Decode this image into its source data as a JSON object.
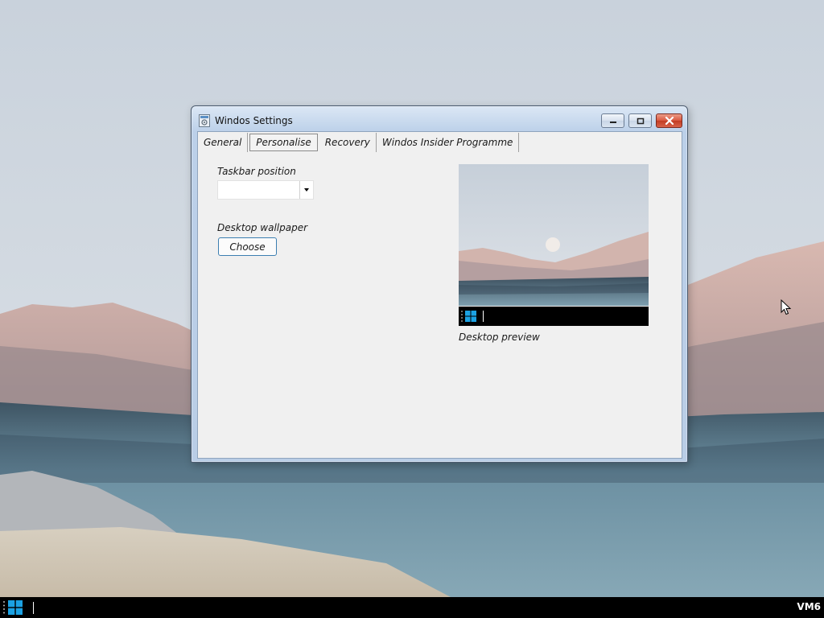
{
  "window": {
    "title": "Windos Settings",
    "tabs": [
      {
        "label": "General",
        "active": false
      },
      {
        "label": "Personalise",
        "active": true
      },
      {
        "label": "Recovery",
        "active": false
      },
      {
        "label": "Windos Insider Programme",
        "active": false
      }
    ]
  },
  "personalise": {
    "taskbar_position_label": "Taskbar position",
    "taskbar_position_value": "",
    "desktop_wallpaper_label": "Desktop wallpaper",
    "choose_button_label": "Choose",
    "desktop_preview_label": "Desktop preview"
  },
  "taskbar": {
    "tray_text": "VM6"
  },
  "icons": {
    "start": "windows-logo-icon",
    "app": "settings-app-icon",
    "cursor": "mouse-pointer-icon"
  },
  "colors": {
    "accent": "#3c7fb1",
    "start_blue": "#1ba1e2",
    "close_red": "#c9452d",
    "taskbar_bg": "#000000"
  }
}
